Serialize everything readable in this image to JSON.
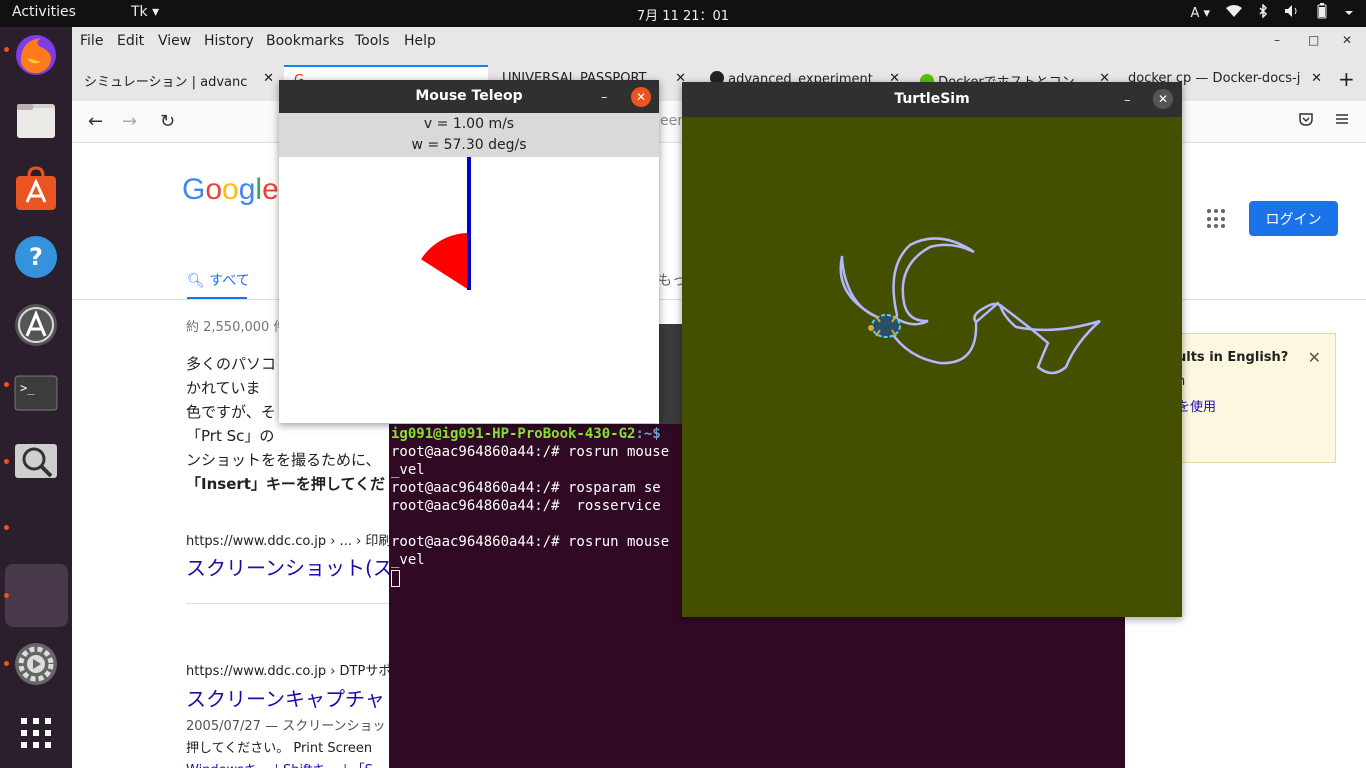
{
  "topbar": {
    "activities": "Activities",
    "app_menu": "Tk ▾",
    "clock": "7月 11  21：01",
    "input_method": "A ▾"
  },
  "dock": {
    "items": [
      "firefox-icon",
      "files-icon",
      "software-center-icon",
      "help-icon",
      "software-updater-icon",
      "terminal-icon",
      "screenshot-icon",
      "blank-app-icon",
      "settings-icon",
      "show-apps-icon"
    ]
  },
  "firefox": {
    "menu": [
      "File",
      "Edit",
      "View",
      "History",
      "Bookmarks",
      "Tools",
      "Help"
    ],
    "tabs": [
      "シミュレーション | advanc",
      "G",
      "UNIVERSAL PASSPORT",
      "advanced_experiment",
      "Dockerでホストとコン",
      "docker cp — Docker-docs-j"
    ],
    "nav": {
      "back": "←",
      "forward": "→",
      "reload": "↻",
      "address_fragment": "een"
    }
  },
  "google": {
    "logo": "Google",
    "tab_all": "すべて",
    "tab_more_fragment": "もっ",
    "login": "ログイン",
    "result_count": "約 2,550,000 件",
    "snippet_lines": [
      "多くのパソコ",
      "かれていま",
      "色ですが、そ",
      "「Prt Sc」の",
      "ンショットをを撮るために、",
      "「Insert」キーを押してくだ"
    ],
    "results": [
      {
        "url": "https://www.ddc.co.jp › ... › 印刷デ",
        "title": "スクリーンショット(ス"
      },
      {
        "url": "https://www.ddc.co.jp › DTPサポ",
        "title": "スクリーンキャプチャ",
        "date_text": "2005/07/27 — スクリーンショッ",
        "text2": "押してください。 Print Screen",
        "text3": "Windowsキー＋Shiftキー＋「S..."
      }
    ],
    "english_box": {
      "title": "ults in English?",
      "line1": "h",
      "line2": "を使用"
    }
  },
  "terminal": {
    "lines": [
      {
        "user": "ig091@ig091-HP-ProBook-430-G2",
        "path": ":~$",
        "text": ""
      },
      {
        "text": "root@aac964860a44:/# rosrun mouse"
      },
      {
        "text": "_vel"
      },
      {
        "text": "root@aac964860a44:/# rosparam se"
      },
      {
        "text": "root@aac964860a44:/#  rosservice"
      },
      {
        "text": ""
      },
      {
        "text": "root@aac964860a44:/# rosrun mouse"
      },
      {
        "text": "_vel"
      }
    ]
  },
  "teleop": {
    "title": "Mouse Teleop",
    "v_text": "v = 1.00 m/s",
    "w_text": "w = 57.30 deg/s",
    "linear_velocity": 1.0,
    "angular_velocity_deg": 57.3,
    "colors": {
      "wedge": "#ff0000",
      "bar": "#0000cc"
    }
  },
  "turtlesim": {
    "title": "TurtleSim",
    "background": "#454f00",
    "path_color": "#b3b8ff"
  },
  "window_controls": {
    "minimize": "–",
    "maximize": "□",
    "close": "✕"
  }
}
